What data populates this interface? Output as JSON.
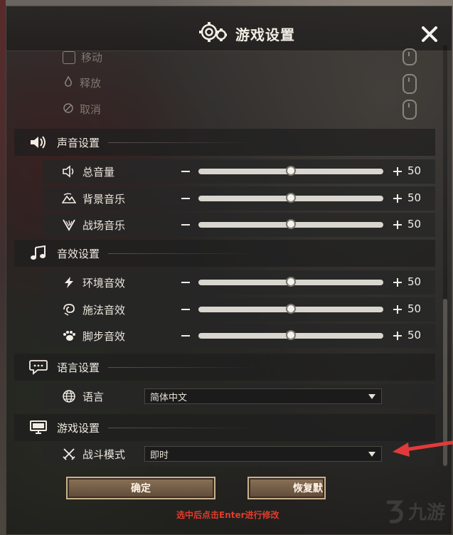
{
  "window": {
    "title": "游戏设置",
    "close_label": "✕"
  },
  "faded_rows": [
    {
      "label": "移动"
    },
    {
      "label": "释放"
    },
    {
      "label": "取消"
    }
  ],
  "sections": {
    "sound": {
      "label": "声音设置",
      "rows": [
        {
          "label": "总音量",
          "value": "50",
          "level": 0.5
        },
        {
          "label": "背景音乐",
          "value": "50",
          "level": 0.5
        },
        {
          "label": "战场音乐",
          "value": "50",
          "level": 0.5
        }
      ]
    },
    "sfx": {
      "label": "音效设置",
      "rows": [
        {
          "label": "环境音效",
          "value": "50",
          "level": 0.5
        },
        {
          "label": "施法音效",
          "value": "50",
          "level": 0.5
        },
        {
          "label": "脚步音效",
          "value": "50",
          "level": 0.5
        }
      ]
    },
    "language": {
      "label": "语言设置",
      "row": {
        "label": "语言",
        "selected": "简体中文"
      }
    },
    "game": {
      "label": "游戏设置",
      "row": {
        "label": "战斗模式",
        "selected": "即时"
      }
    }
  },
  "buttons": {
    "confirm": "确定",
    "reset": "恢复默"
  },
  "hint": "选中后点击Enter进行修改",
  "watermark": "九游",
  "colors": {
    "hint": "#e33b2c",
    "arrow": "#e23a3a",
    "button_border": "#c9b18c"
  }
}
